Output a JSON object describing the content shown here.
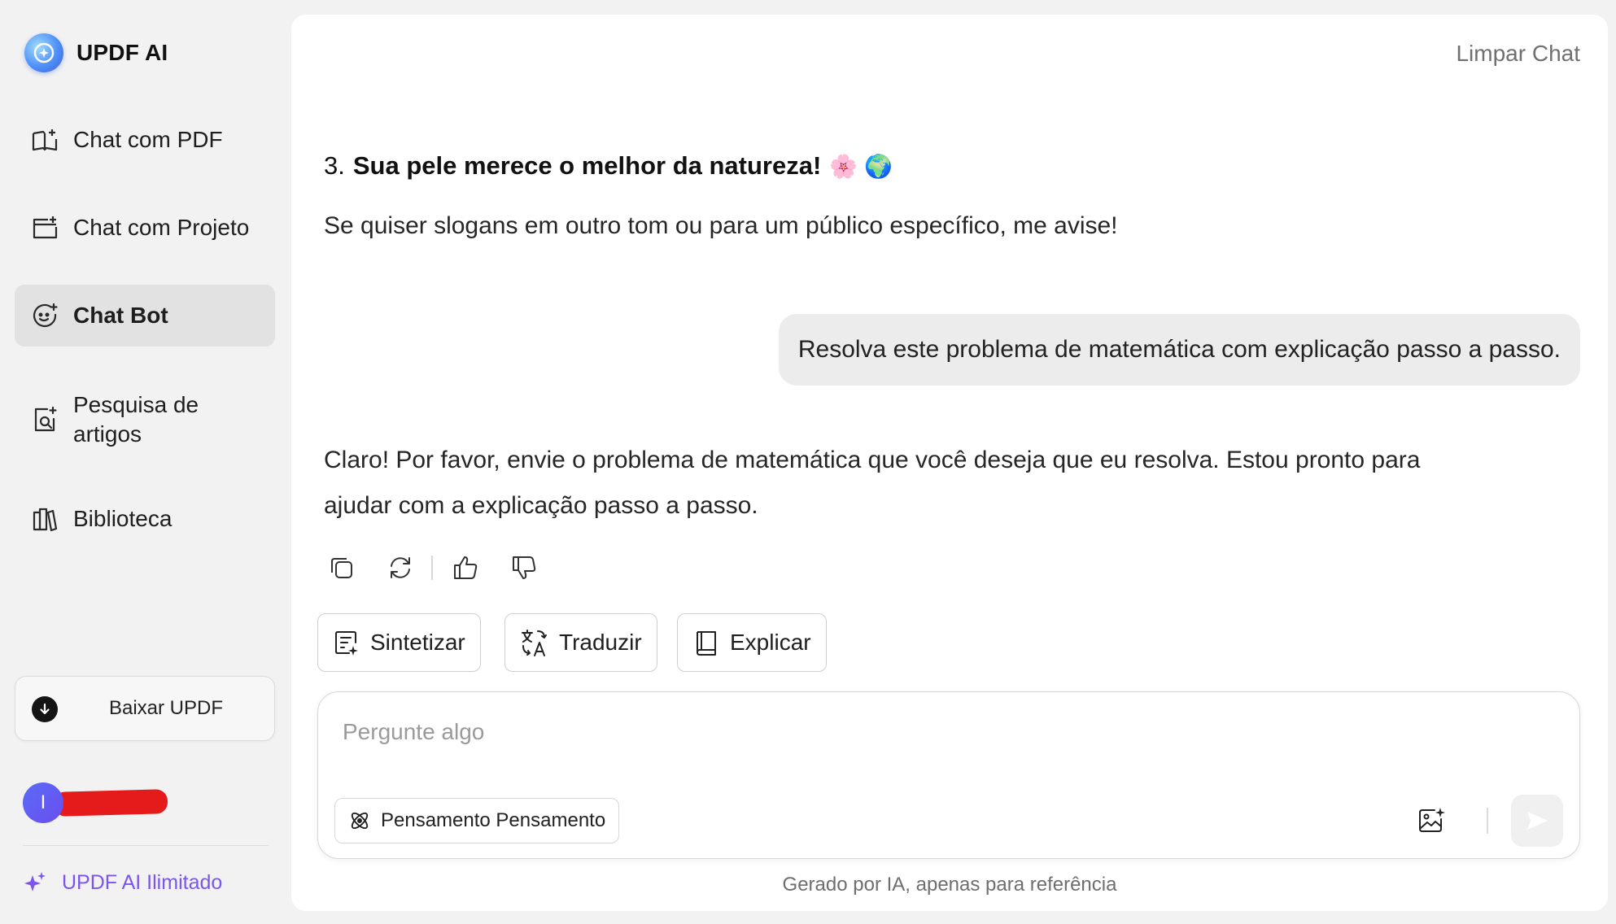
{
  "brand": {
    "name": "UPDF AI",
    "logo_icon": "updf-ai-logo-icon"
  },
  "sidebar": {
    "items": [
      {
        "label": "Chat com PDF",
        "icon": "book-sparkle-icon"
      },
      {
        "label": "Chat com Projeto",
        "icon": "folder-sparkle-icon"
      },
      {
        "label": "Chat Bot",
        "icon": "bot-face-icon",
        "active": true
      },
      {
        "label": "Pesquisa de artigos",
        "icon": "document-search-icon"
      },
      {
        "label": "Biblioteca",
        "icon": "library-books-icon"
      }
    ],
    "download_label": "Baixar UPDF",
    "user_initial": "I",
    "unlimited_label": "UPDF AI Ilimitado"
  },
  "header": {
    "clear_label": "Limpar Chat"
  },
  "chat": {
    "slogan_number": "3.",
    "slogan_text": "Sua pele merece o melhor da natureza!",
    "slogan_emoji": "🌸 🌍",
    "assistant_followup": "Se quiser slogans em outro tom ou para um público específico, me avise!",
    "user_message": "Resolva este problema de matemática com explicação passo a passo.",
    "assistant_reply_line1": "Claro! Por favor, envie o problema de matemática que você deseja que eu resolva. Estou pronto para",
    "assistant_reply_line2": "ajudar com a explicação passo a passo."
  },
  "quick_actions": [
    {
      "label": "Sintetizar",
      "icon": "summarize-icon"
    },
    {
      "label": "Traduzir",
      "icon": "translate-icon"
    },
    {
      "label": "Explicar",
      "icon": "book-icon"
    }
  ],
  "input": {
    "placeholder": "Pergunte algo",
    "thinking_label": "Pensamento Pensamento"
  },
  "footer_note": "Gerado por IA, apenas para referência",
  "colors": {
    "accent": "#7b55ee",
    "active_bg": "#e2e2e2",
    "bubble_bg": "#ececec"
  }
}
